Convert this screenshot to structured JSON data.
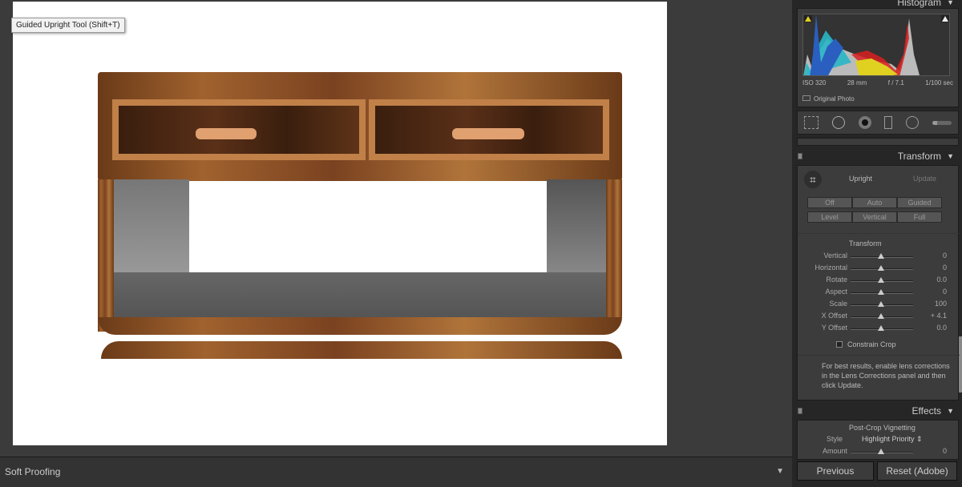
{
  "tooltip": "Guided Upright Tool (Shift+T)",
  "bottombar": {
    "label": "Soft Proofing"
  },
  "histogram": {
    "title": "Histogram",
    "iso": "ISO 320",
    "focal": "28 mm",
    "aperture": "f / 7.1",
    "shutter": "1/100 sec",
    "original_photo": "Original Photo"
  },
  "tools": [
    "grid-crop-icon",
    "spot-removal-icon",
    "red-eye-icon",
    "graduated-filter-icon",
    "radial-filter-icon",
    "adjustment-brush-icon"
  ],
  "transform": {
    "title": "Transform",
    "upright": "Upright",
    "update": "Update",
    "modes": [
      "Off",
      "Auto",
      "Guided",
      "Level",
      "Vertical",
      "Full"
    ],
    "section": "Transform",
    "sliders": [
      {
        "label": "Vertical",
        "value": "0"
      },
      {
        "label": "Horizontal",
        "value": "0"
      },
      {
        "label": "Rotate",
        "value": "0.0"
      },
      {
        "label": "Aspect",
        "value": "0"
      },
      {
        "label": "Scale",
        "value": "100"
      },
      {
        "label": "X Offset",
        "value": "+ 4.1"
      },
      {
        "label": "Y Offset",
        "value": "0.0"
      }
    ],
    "constrain": "Constrain Crop",
    "hint": "For best results, enable lens corrections in the Lens Corrections panel and then click Update."
  },
  "effects": {
    "title": "Effects",
    "section": "Post-Crop Vignetting",
    "style_label": "Style",
    "style_value": "Highlight Priority",
    "amount_label": "Amount",
    "amount_value": "0"
  },
  "buttons": {
    "previous": "Previous",
    "reset": "Reset (Adobe)"
  }
}
